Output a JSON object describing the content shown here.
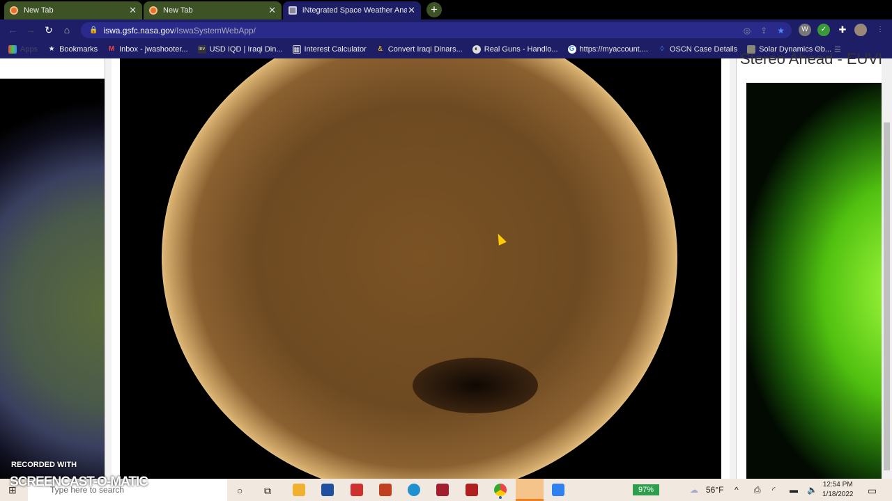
{
  "tabs": [
    {
      "title": "New Tab"
    },
    {
      "title": "New Tab"
    },
    {
      "title": "iNtegrated Space Weather Analy"
    }
  ],
  "address": {
    "host": "iswa.gsfc.nasa.gov",
    "path": "/IswaSystemWebApp/"
  },
  "bookmarks": [
    "Apps",
    "Bookmarks",
    "Inbox - jwashooter...",
    "USD IQD | Iraqi Din...",
    "Interest Calculator",
    "Convert Iraqi Dinars...",
    "Real Guns - Handlo...",
    "https://myaccount....",
    "OSCN Case Details",
    "Solar Dynamics Ob..."
  ],
  "right_panel": {
    "title": "Stereo Ahead - EUVI"
  },
  "watermark": {
    "line1": "RECORDED WITH",
    "line2": "SCREENCAST-O-MATIC"
  },
  "taskbar": {
    "search_placeholder": "Type here to search",
    "battery": "97%",
    "weather": "56°F",
    "time": "12:54 PM",
    "date": "1/18/2022"
  }
}
